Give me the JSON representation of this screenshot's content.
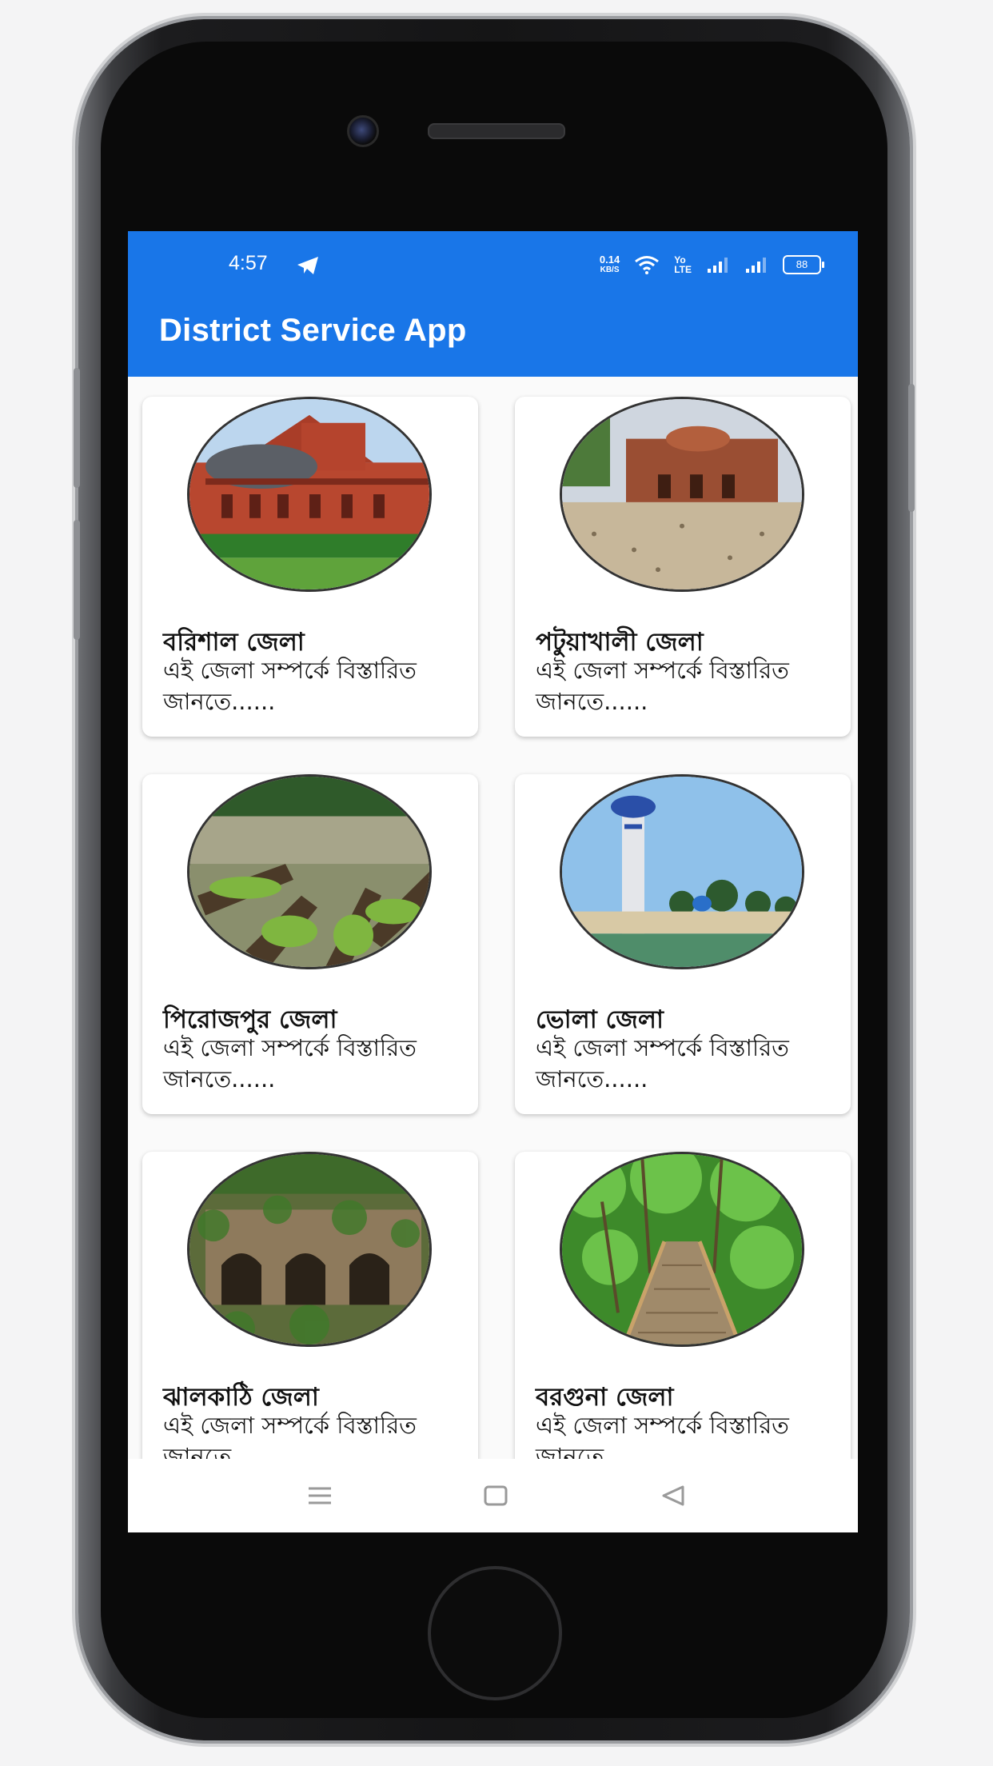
{
  "status_bar": {
    "time": "4:57",
    "network_speed_value": "0.14",
    "network_speed_unit": "KB/S",
    "volte_top": "Yo",
    "volte_bottom": "LTE",
    "battery": "88",
    "icons": [
      "telegram-icon",
      "wifi-icon",
      "signal-icon",
      "signal-icon",
      "battery-icon"
    ]
  },
  "app_bar": {
    "title": "District Service App"
  },
  "districts": [
    {
      "name": "বরিশাল জেলা",
      "desc": "এই জেলা সম্পর্কে বিস্তারিত জানতে......"
    },
    {
      "name": "পটুয়াখালী জেলা",
      "desc": "এই জেলা সম্পর্কে বিস্তারিত জানতে......"
    },
    {
      "name": "পিরোজপুর জেলা",
      "desc": "এই জেলা সম্পর্কে বিস্তারিত জানতে......"
    },
    {
      "name": "ভোলা জেলা",
      "desc": "এই জেলা সম্পর্কে বিস্তারিত জানতে......"
    },
    {
      "name": "ঝালকাঠি জেলা",
      "desc": "এই জেলা সম্পর্কে বিস্তারিত জানতে......"
    },
    {
      "name": "বরগুনা জেলা",
      "desc": "এই জেলা সম্পর্কে বিস্তারিত জানতে......"
    }
  ],
  "nav_bar": {
    "icons": [
      "menu-icon",
      "home-square-icon",
      "back-triangle-icon"
    ]
  },
  "colors": {
    "app_bar": "#1976e8",
    "card_bg": "#ffffff",
    "text": "#111111"
  }
}
